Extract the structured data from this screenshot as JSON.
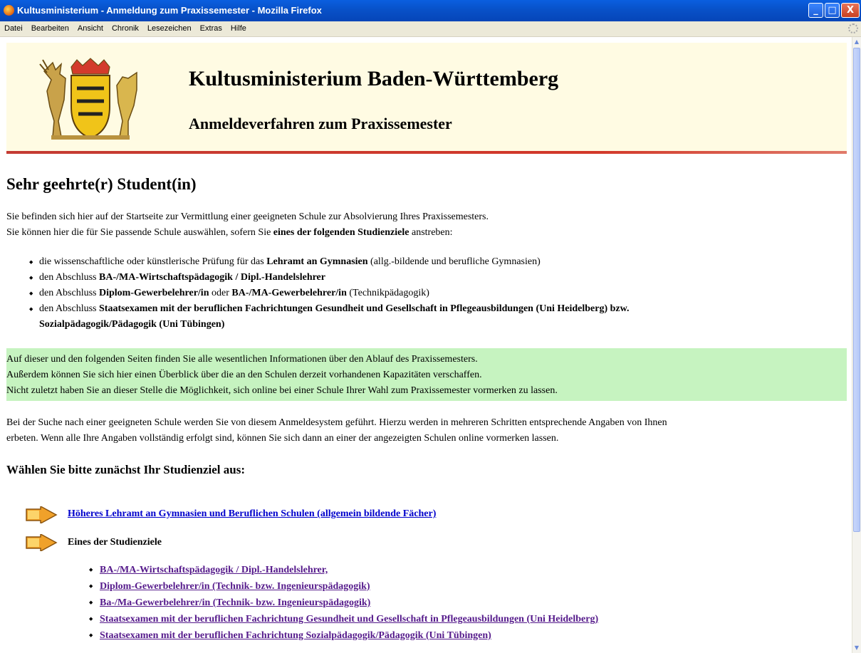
{
  "window": {
    "title": "Kultusministerium - Anmeldung zum Praxissemester - Mozilla Firefox"
  },
  "menu": [
    "Datei",
    "Bearbeiten",
    "Ansicht",
    "Chronik",
    "Lesezeichen",
    "Extras",
    "Hilfe"
  ],
  "header": {
    "title": "Kultusministerium Baden-Württemberg",
    "subtitle": "Anmeldeverfahren zum Praxissemester"
  },
  "greeting": "Sehr geehrte(r) Student(in)",
  "intro": {
    "line1": "Sie befinden sich hier auf der Startseite zur Vermittlung einer geeigneten Schule zur Absolvierung Ihres Praxissemesters.",
    "line2_pre": "Sie können hier die für Sie passende Schule auswählen, sofern Sie ",
    "line2_bold": "eines der folgenden Studienziele",
    "line2_post": " anstreben:"
  },
  "goals": [
    {
      "pre": "die wissenschaftliche oder künstlerische Prüfung für das ",
      "bold": "Lehramt an Gymnasien",
      "post": " (allg.-bildende und berufliche Gymnasien)"
    },
    {
      "pre": "den Abschluss ",
      "bold": "BA-/MA-Wirtschaftspädagogik / Dipl.-Handelslehrer",
      "post": ""
    },
    {
      "pre": "den Abschluss ",
      "bold": "Diplom-Gewerbelehrer/in",
      "mid": " oder ",
      "bold2": "BA-/MA-Gewerbelehrer/in",
      "post": " (Technikpädagogik)"
    },
    {
      "pre": "den Abschluss ",
      "bold": "Staatsexamen mit der beruflichen Fachrichtungen Gesundheit und Gesellschaft in Pflegeausbildungen (Uni Heidelberg) bzw.",
      "bold_line2": "Sozialpädagogik/Pädagogik (Uni Tübingen)"
    }
  ],
  "info_box": [
    "Auf dieser und den folgenden Seiten finden Sie alle wesentlichen Informationen über den Ablauf des Praxissemesters.",
    "Außerdem können Sie sich hier einen Überblick über die an den Schulen derzeit vorhandenen Kapazitäten verschaffen.",
    "Nicht zuletzt haben Sie an dieser Stelle die Möglichkeit, sich online bei einer Schule Ihrer Wahl zum Praxissemester vormerken zu lassen."
  ],
  "search_text": {
    "line1": "Bei der Suche nach einer geeigneten Schule werden Sie von diesem Anmeldesystem geführt. Hierzu werden in mehreren Schritten entsprechende Angaben von Ihnen",
    "line2": "erbeten. Wenn alle Ihre Angaben vollständig erfolgt sind, können Sie sich dann an einer der angezeigten Schulen online vormerken lassen."
  },
  "choose_heading": "Wählen Sie bitte zunächst Ihr Studienziel aus:",
  "option1_link": "Höheres Lehramt an Gymnasien und Beruflichen Schulen (allgemein bildende Fächer)",
  "option2_label": "Eines der Studienziele",
  "sub_links": [
    "BA-/MA-Wirtschaftspädagogik / Dipl.-Handelslehrer,",
    "Diplom-Gewerbelehrer/in (Technik- bzw. Ingenieurspädagogik)",
    "Ba-/Ma-Gewerbelehrer/in (Technik- bzw. Ingenieurspädagogik)",
    "Staatsexamen mit der beruflichen Fachrichtung Gesundheit und Gesellschaft in Pflegeausbildungen (Uni Heidelberg)",
    "Staatsexamen mit der beruflichen Fachrichtung Sozialpädagogik/Pädagogik (Uni Tübingen)"
  ],
  "colors": {
    "header_bg": "#fffbe3",
    "header_rule": "#c43b33",
    "info_bg": "#c6f3c0",
    "link": "#0000cc",
    "visited_link": "#551a8b"
  },
  "icons": {
    "browser": "firefox-icon",
    "crest": "coat-of-arms-icon",
    "choice_arrow": "arrow-right-icon"
  }
}
